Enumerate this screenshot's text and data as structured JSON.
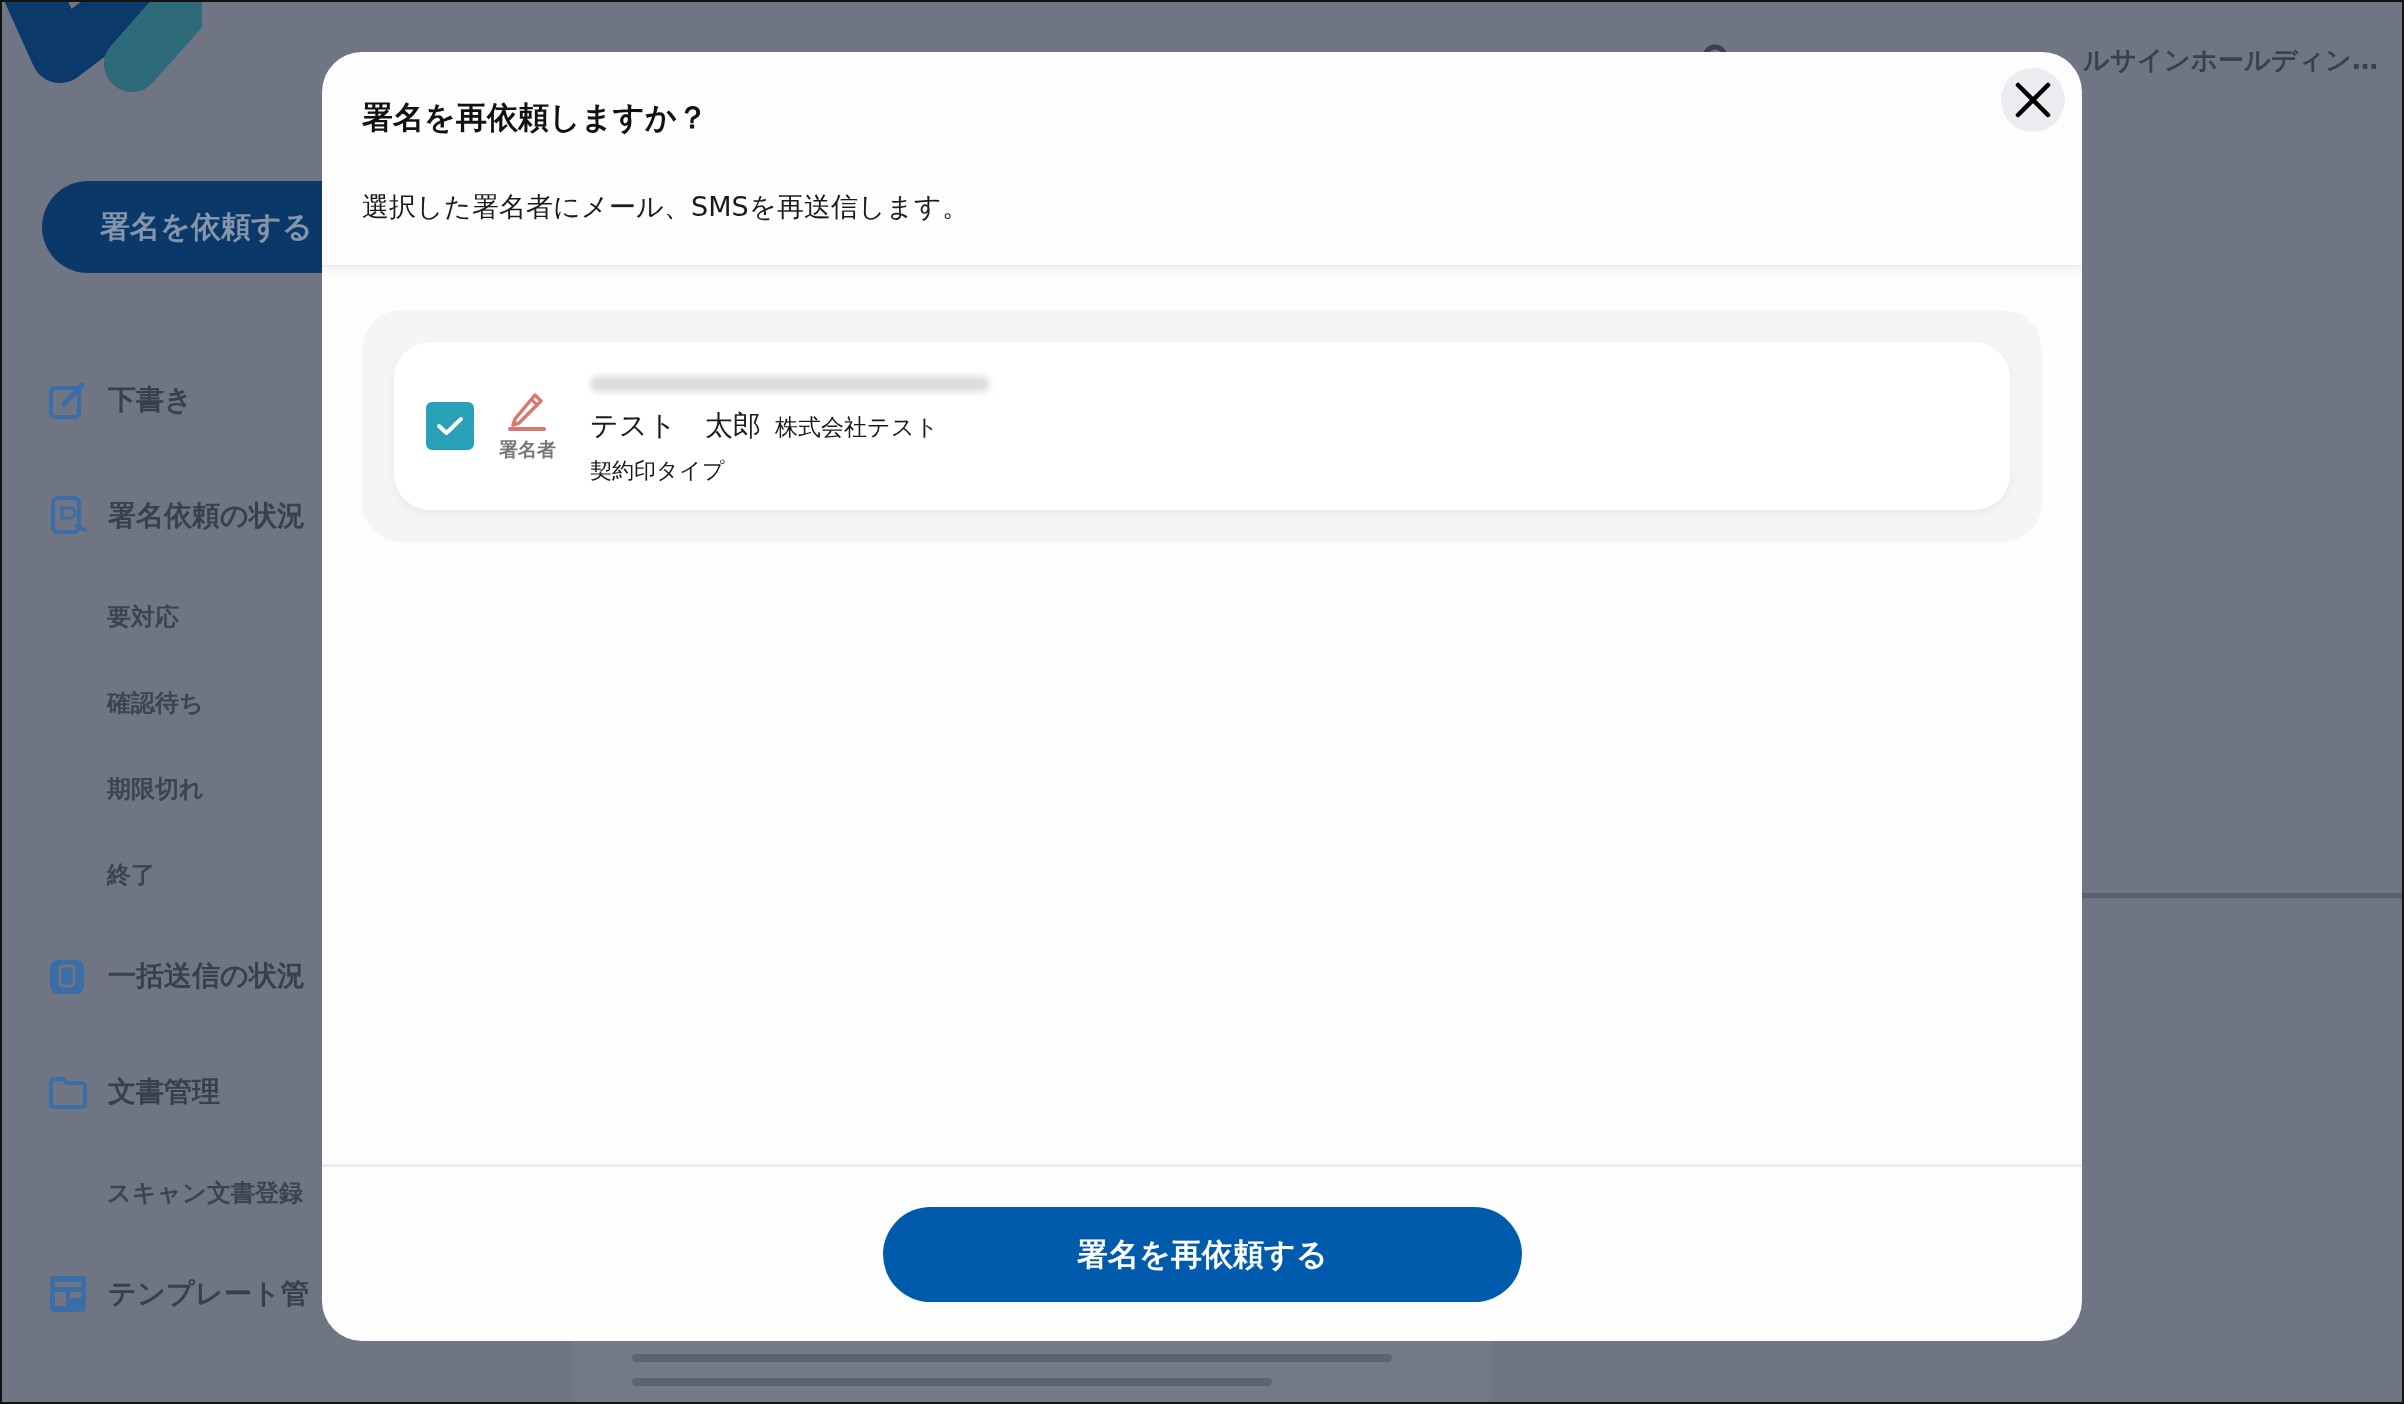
{
  "sidebar": {
    "primary_button": "署名を依頼する",
    "items": [
      {
        "label": "下書き"
      },
      {
        "label": "署名依頼の状況",
        "children": [
          {
            "label": "要対応"
          },
          {
            "label": "確認待ち"
          },
          {
            "label": "期限切れ"
          },
          {
            "label": "終了"
          }
        ]
      },
      {
        "label": "一括送信の状況"
      },
      {
        "label": "文書管理",
        "children": [
          {
            "label": "スキャン文書登録"
          }
        ]
      },
      {
        "label": "テンプレート管"
      }
    ]
  },
  "header": {
    "account": "ルサインホールディン…"
  },
  "dialog": {
    "title": "署名を再依頼しますか？",
    "message": "選択した署名者にメール、SMSを再送信します。",
    "signers": [
      {
        "checked": true,
        "role": "署名者",
        "name": "テスト　太郎",
        "company": "株式会社テスト",
        "seal_type": "契約印タイプ"
      }
    ],
    "submit_button": "署名を再依頼する"
  }
}
